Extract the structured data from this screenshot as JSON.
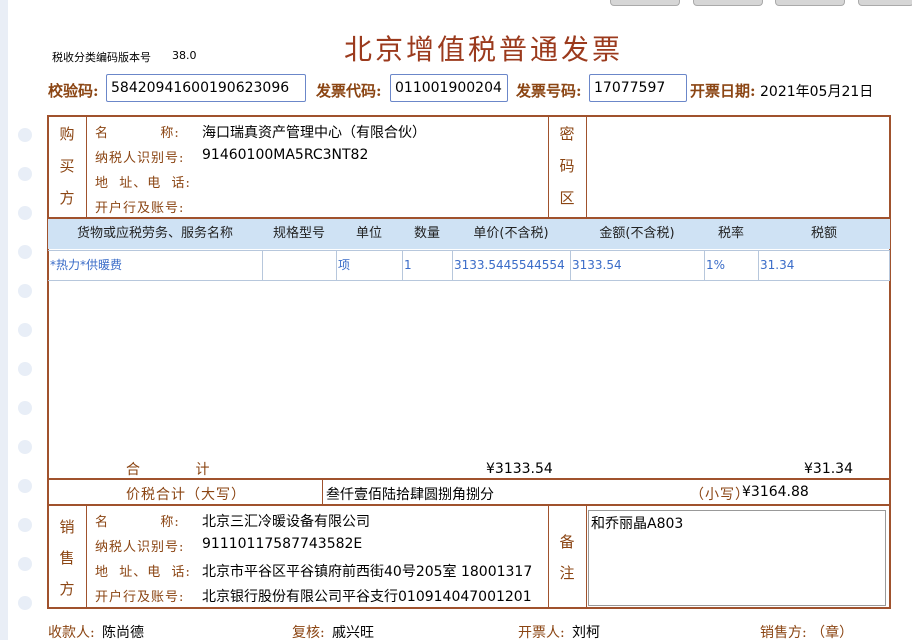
{
  "header": {
    "version_label": "税收分类编码版本号",
    "version_value": "38.0",
    "title": "北京增值税普通发票",
    "check_code_label": "校验码:",
    "check_code": "58420941600190623096",
    "invoice_code_label": "发票代码:",
    "invoice_code": "011001900204",
    "invoice_number_label": "发票号码:",
    "invoice_number": "17077597",
    "date_label": "开票日期:",
    "date": "2021年05月21日"
  },
  "buyer": {
    "side_label": [
      "购",
      "买",
      "方"
    ],
    "name_label": "名          称:",
    "name": "海口瑞真资产管理中心（有限合伙）",
    "tax_id_label": "纳税人识别号:",
    "tax_id": "91460100MA5RC3NT82",
    "address_label": "地  址、电  话:",
    "address": "",
    "bank_label": "开户行及账号:",
    "bank": ""
  },
  "cipher": {
    "side_label": [
      "密",
      "码",
      "区"
    ]
  },
  "items_table": {
    "headers": [
      "货物或应税劳务、服务名称",
      "规格型号",
      "单位",
      "数量",
      "单价(不含税)",
      "金额(不含税)",
      "税率",
      "税额"
    ],
    "rows": [
      [
        "*热力*供暖费",
        "",
        "项",
        "1",
        "3133.5445544554",
        "3133.54",
        "1%",
        "31.34"
      ]
    ]
  },
  "totals": {
    "label": "合          计",
    "amount": "¥3133.54",
    "tax": "¥31.34",
    "total_label": "价税合计（大写）",
    "total_words": "叁仟壹佰陆拾肆圆捌角捌分",
    "small_label": "（小写）",
    "total_small": "¥3164.88"
  },
  "seller": {
    "side_label": [
      "销",
      "售",
      "方"
    ],
    "name_label": "名          称:",
    "name": "北京三汇冷暖设备有限公司",
    "tax_id_label": "纳税人识别号:",
    "tax_id": "91110117587743582E",
    "address_label": "地  址、电  话:",
    "address": "北京市平谷区平谷镇府前西街40号205室 18001317",
    "bank_label": "开户行及账号:",
    "bank": "北京银行股份有限公司平谷支行010914047001201"
  },
  "remarks": {
    "side_label": [
      "备",
      "注"
    ],
    "text": "和乔丽晶A803"
  },
  "footer": {
    "payee_label": "收款人:",
    "payee": "陈尚德",
    "reviewer_label": "复核:",
    "reviewer": "戚兴旺",
    "drawer_label": "开票人:",
    "drawer": "刘柯",
    "seller_label": "销售方: （章）"
  }
}
